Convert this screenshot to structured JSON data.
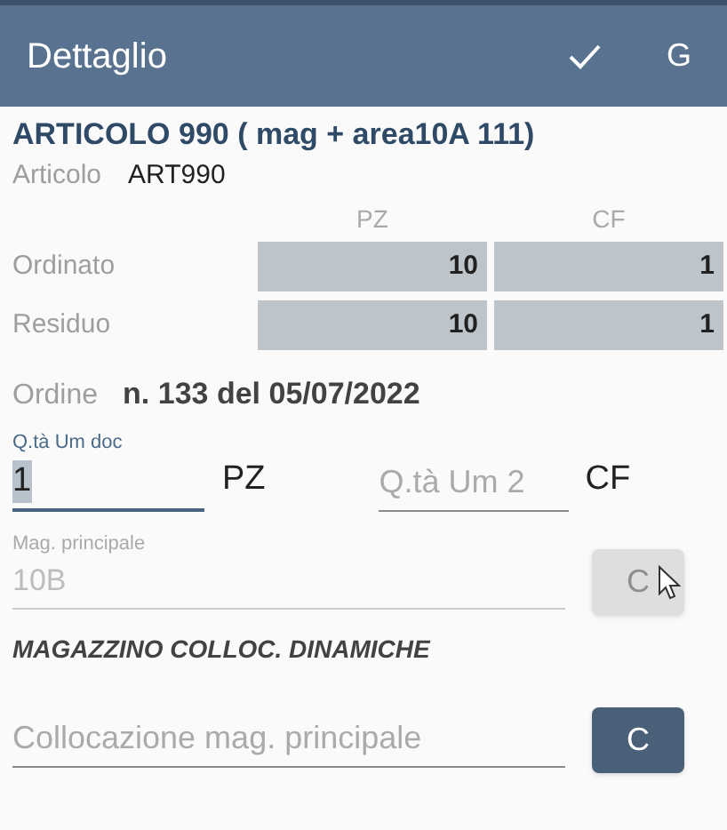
{
  "app_bar": {
    "title": "Dettaglio",
    "actions": [
      {
        "kind": "check"
      },
      {
        "kind": "text",
        "label": "G"
      }
    ]
  },
  "heading": "ARTICOLO 990 ( mag + area10A 111)",
  "article": {
    "label": "Articolo",
    "value": "ART990"
  },
  "quantities": {
    "columns": [
      "PZ",
      "CF"
    ],
    "rows": [
      {
        "label": "Ordinato",
        "values": [
          "10",
          "1"
        ]
      },
      {
        "label": "Residuo",
        "values": [
          "10",
          "1"
        ]
      }
    ]
  },
  "order": {
    "label": "Ordine",
    "value": "n. 133 del 05/07/2022"
  },
  "qty_doc": {
    "label": "Q.tà Um doc",
    "value": "1",
    "unit": "PZ",
    "focused": true
  },
  "qty_um2": {
    "placeholder": "Q.tà Um 2",
    "unit": "CF",
    "focused": false
  },
  "mag_principale": {
    "label": "Mag. principale",
    "value": "10B",
    "disabled": true,
    "button": {
      "label": "C",
      "disabled": true
    }
  },
  "section_title": "MAGAZZINO COLLOC. DINAMICHE",
  "collocazione": {
    "placeholder": "Collocazione mag. principale",
    "disabled": false,
    "button": {
      "label": "C",
      "disabled": false
    }
  }
}
